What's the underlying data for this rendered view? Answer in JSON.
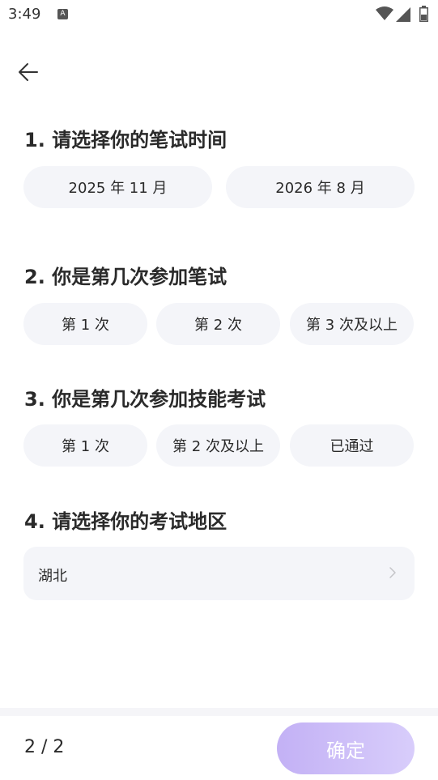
{
  "status_bar": {
    "time": "3:49",
    "notification_icon_letter": "A"
  },
  "questions": [
    {
      "title": "1. 请选择你的笔试时间",
      "options": [
        "2025 年 11 月",
        "2026 年 8 月"
      ]
    },
    {
      "title": "2. 你是第几次参加笔试",
      "options": [
        "第 1 次",
        "第 2 次",
        "第 3 次及以上"
      ]
    },
    {
      "title": "3. 你是第几次参加技能考试",
      "options": [
        "第 1 次",
        "第 2 次及以上",
        "已通过"
      ]
    },
    {
      "title": "4. 请选择你的考试地区",
      "selected_region": "湖北"
    }
  ],
  "footer": {
    "pager": "2 / 2",
    "confirm_label": "确定"
  },
  "colors": {
    "option_bg": "#f4f5f9",
    "confirm_gradient_start": "#c3b1f5",
    "confirm_gradient_end": "#d8cdfb"
  }
}
